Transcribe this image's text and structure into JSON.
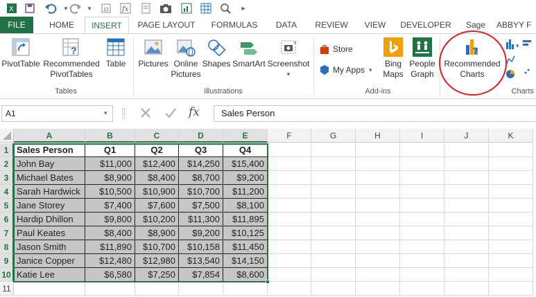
{
  "qat": {
    "undo_hint": "undo",
    "redo_hint": "redo"
  },
  "tabs": [
    "FILE",
    "HOME",
    "INSERT",
    "PAGE LAYOUT",
    "FORMULAS",
    "DATA",
    "REVIEW",
    "VIEW",
    "DEVELOPER",
    "Sage",
    "ABBYY F"
  ],
  "ribbon": {
    "pivottable": "PivotTable",
    "recommended_pivottables_1": "Recommended",
    "recommended_pivottables_2": "PivotTables",
    "table": "Table",
    "tables_group": "Tables",
    "pictures": "Pictures",
    "online_pictures_1": "Online",
    "online_pictures_2": "Pictures",
    "shapes": "Shapes",
    "smartart": "SmartArt",
    "screenshot": "Screenshot",
    "illustrations_group": "Illustrations",
    "store": "Store",
    "my_apps": "My Apps",
    "bing_maps_1": "Bing",
    "bing_maps_2": "Maps",
    "people_graph_1": "People",
    "people_graph_2": "Graph",
    "addins_group": "Add-ins",
    "recommended_charts_1": "Recommended",
    "recommended_charts_2": "Charts",
    "charts_group": "Charts"
  },
  "formula_bar": {
    "name_box": "A1",
    "fx": "fx",
    "content": "Sales Person"
  },
  "columns": [
    "A",
    "B",
    "C",
    "D",
    "E",
    "F",
    "G",
    "H",
    "I",
    "J",
    "K"
  ],
  "rows": [
    "1",
    "2",
    "3",
    "4",
    "5",
    "6",
    "7",
    "8",
    "9",
    "10",
    "11"
  ],
  "table": {
    "headers": [
      "Sales Person",
      "Q1",
      "Q2",
      "Q3",
      "Q4"
    ],
    "rows": [
      [
        "John Bay",
        "$11,000",
        "$12,400",
        "$14,250",
        "$15,400"
      ],
      [
        "Michael Bates",
        "$8,900",
        "$8,400",
        "$8,700",
        "$9,200"
      ],
      [
        "Sarah Hardwick",
        "$10,500",
        "$10,900",
        "$10,700",
        "$11,200"
      ],
      [
        "Jane Storey",
        "$7,400",
        "$7,600",
        "$7,500",
        "$8,100"
      ],
      [
        "Hardip Dhillon",
        "$9,800",
        "$10,200",
        "$11,300",
        "$11,895"
      ],
      [
        "Paul Keates",
        "$8,400",
        "$8,900",
        "$9,200",
        "$10,125"
      ],
      [
        "Jason Smith",
        "$11,890",
        "$10,700",
        "$10,158",
        "$11,450"
      ],
      [
        "Janice Copper",
        "$12,480",
        "$12,980",
        "$13,540",
        "$14,150"
      ],
      [
        "Katie Lee",
        "$6,580",
        "$7,250",
        "$7,854",
        "$8,600"
      ]
    ]
  },
  "colors": {
    "excel_green": "#217346",
    "highlight_circle": "#e02020",
    "selection_fill": "#c6c6c6"
  }
}
